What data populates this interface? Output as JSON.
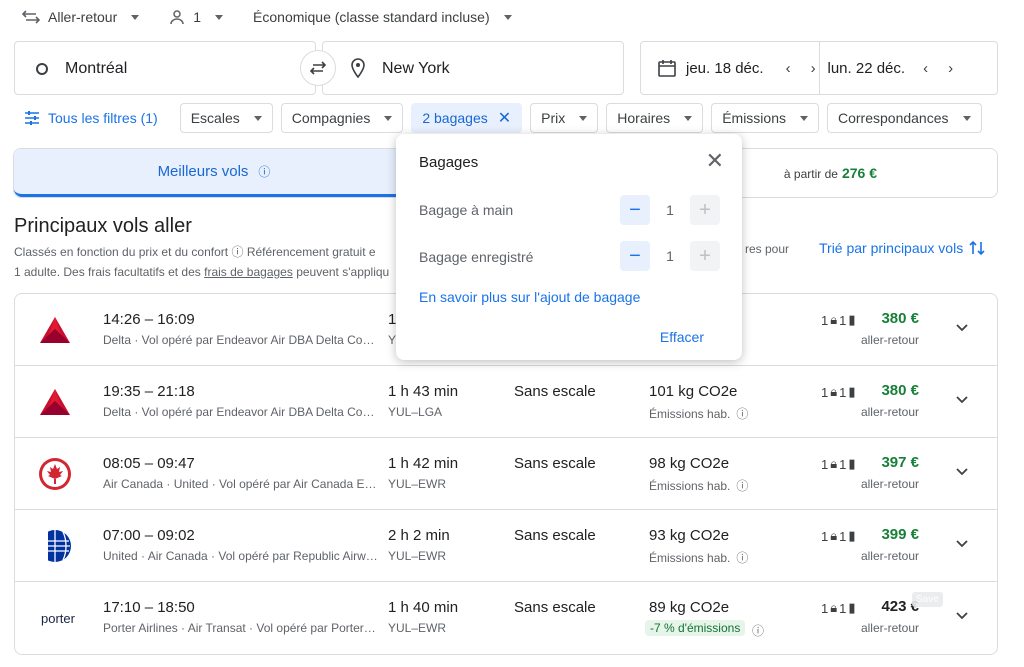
{
  "topbar": {
    "trip_type": "Aller-retour",
    "passengers": "1",
    "cabin": "Économique (classe standard incluse)"
  },
  "search": {
    "origin": "Montréal",
    "destination": "New York",
    "depart_date": "jeu. 18 déc.",
    "return_date": "lun. 22 déc."
  },
  "filters": {
    "all_filters": "Tous les filtres (1)",
    "chips": [
      "Escales",
      "Compagnies",
      "2 bagages",
      "Prix",
      "Horaires",
      "Émissions",
      "Correspondances"
    ]
  },
  "tabs": {
    "best": "Meilleurs vols",
    "cheapest_prefix": "à partir de",
    "cheapest_price": "276 €"
  },
  "results": {
    "title": "Principaux vols aller",
    "subtitle_1": "Classés en fonction du prix et du confort",
    "subtitle_1b": "Référencement gratuit e",
    "subtitle_2": "1 adulte. Des frais facultatifs et des",
    "subtitle_2_link": "frais de bagages",
    "subtitle_2b": "peuvent s'appliqu",
    "subtitle_right": "res pour",
    "sort_label": "Trié par principaux vols"
  },
  "flights": [
    {
      "times": "14:26 – 16:09",
      "airline": "Delta · Vol opéré par Endeavor Air DBA Delta Con…",
      "duration": "1",
      "route": "Y",
      "stops": "",
      "co2": "",
      "emissions": "",
      "bags_carry": "1",
      "bags_checked": "1",
      "price": "380 €",
      "price_label": "aller-retour",
      "logo": "delta"
    },
    {
      "times": "19:35 – 21:18",
      "airline": "Delta · Vol opéré par Endeavor Air DBA Delta Con…",
      "duration": "1 h 43 min",
      "route": "YUL–LGA",
      "stops": "Sans escale",
      "co2": "101 kg CO2e",
      "emissions": "Émissions hab.",
      "bags_carry": "1",
      "bags_checked": "1",
      "price": "380 €",
      "price_label": "aller-retour",
      "logo": "delta"
    },
    {
      "times": "08:05 – 09:47",
      "airline": "Air Canada · United · Vol opéré par Air Canada Ex…",
      "duration": "1 h 42 min",
      "route": "YUL–EWR",
      "stops": "Sans escale",
      "co2": "98 kg CO2e",
      "emissions": "Émissions hab.",
      "bags_carry": "1",
      "bags_checked": "1",
      "price": "397 €",
      "price_label": "aller-retour",
      "logo": "aircanada"
    },
    {
      "times": "07:00 – 09:02",
      "airline": "United · Air Canada · Vol opéré par Republic Airw…",
      "duration": "2 h 2 min",
      "route": "YUL–EWR",
      "stops": "Sans escale",
      "co2": "93 kg CO2e",
      "emissions": "Émissions hab.",
      "bags_carry": "1",
      "bags_checked": "1",
      "price": "399 €",
      "price_label": "aller-retour",
      "logo": "united"
    },
    {
      "times": "17:10 – 18:50",
      "airline": "Porter Airlines · Air Transat · Vol opéré par Porter …",
      "duration": "1 h 40 min",
      "route": "YUL–EWR",
      "stops": "Sans escale",
      "co2": "89 kg CO2e",
      "emissions_badge": "-7 % d'émissions",
      "bags_carry": "1",
      "bags_checked": "1",
      "price": "423 €",
      "price_label": "aller-retour",
      "logo": "porter"
    }
  ],
  "save_chip": "Save",
  "popup": {
    "title": "Bagages",
    "carry_label": "Bagage à main",
    "carry_count": "1",
    "checked_label": "Bagage enregistré",
    "checked_count": "1",
    "learn_more": "En savoir plus sur l'ajout de bagage",
    "clear": "Effacer"
  },
  "logos": {
    "porter_text": "porter"
  }
}
